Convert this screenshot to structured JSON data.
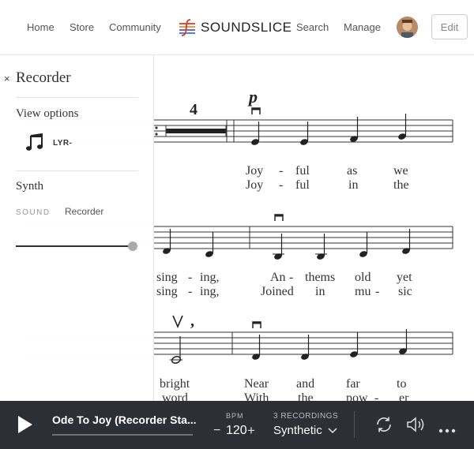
{
  "nav": {
    "links": [
      "Home",
      "Store",
      "Community",
      "Search",
      "Manage"
    ],
    "logo_text": "SOUNDSLICE",
    "edit_label": "Edit"
  },
  "sidebar": {
    "title": "Recorder",
    "close_glyph": "×",
    "view_options_heading": "View options",
    "lyrics_toggle_label": "LYR-",
    "synth_heading": "Synth",
    "sound_label": "SOUND",
    "sound_value": "Recorder",
    "volume_level": 1.0
  },
  "score": {
    "rest_count": "4",
    "dynamic": "p",
    "lyrics": {
      "row1_line1": [
        "Joy",
        "-",
        "ful",
        "as",
        "we"
      ],
      "row1_line2": [
        "Joy",
        "-",
        "ful",
        "in",
        "the"
      ],
      "row2_line1": [
        "sing",
        "-",
        "ing,",
        "An",
        "-",
        "thems",
        "old",
        "yet"
      ],
      "row2_line2": [
        "sing",
        "-",
        "ing,",
        "Joined",
        "in",
        "mu",
        "-",
        "sic"
      ],
      "row3_line1": [
        "bright",
        "Near",
        "and",
        "far",
        "to"
      ],
      "row3_line2": [
        "word",
        "With",
        "the",
        "pow",
        "-",
        "er"
      ]
    }
  },
  "player": {
    "song_title": "Ode To Joy (Recorder Sta...",
    "bpm_label": "BPM",
    "bpm_minus": "−",
    "bpm_value": "120",
    "bpm_plus": "+",
    "recordings_count": "3 RECORDINGS",
    "recording_selected": "Synthetic",
    "progress": 0.0
  },
  "icons": {
    "play": "play-icon",
    "loop": "loop-icon",
    "volume": "speaker-icon",
    "more": "more-icon",
    "close": "close-icon",
    "lyrics": "music-note-icon"
  }
}
